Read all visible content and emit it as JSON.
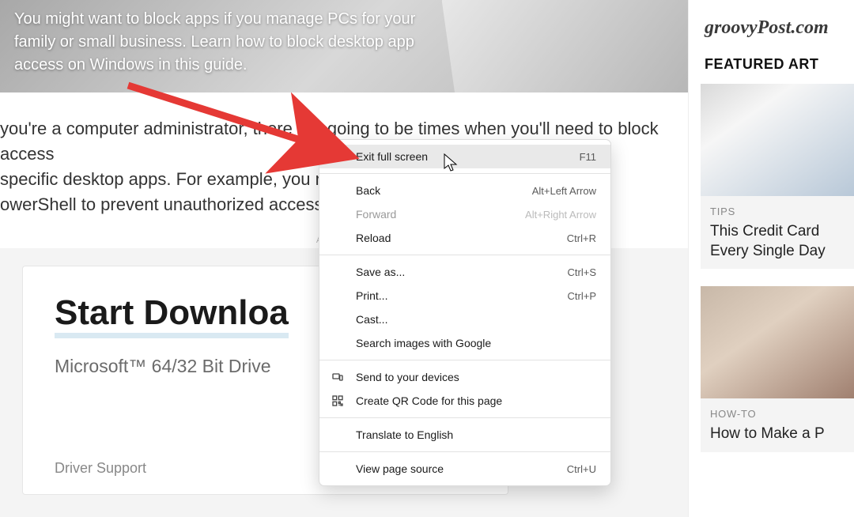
{
  "hero": {
    "text": "You might want to block apps if you manage PCs for your family or small business. Learn how to block desktop app access on Windows in this guide."
  },
  "article": {
    "line1": "you're a computer administrator, there are going to be times when you'll need to block access",
    "line2": "specific desktop apps. For example, you may want to block access to tools like",
    "line3": "owerShell to prevent unauthorized access"
  },
  "ad": {
    "label_row": "Advertisement",
    "headline": "Start Downloa",
    "sub": "Microsoft™ 64/32 Bit Drive",
    "sponsor": "Driver Support"
  },
  "site": {
    "logo": "groovyPost.com",
    "featured_heading": "FEATURED ART"
  },
  "featured": [
    {
      "category": "TIPS",
      "title": "This Credit Card Every Single Day"
    },
    {
      "category": "HOW-TO",
      "title": "How to Make a P"
    }
  ],
  "context_menu": {
    "items": [
      {
        "label": "Exit full screen",
        "shortcut": "F11",
        "highlight": true,
        "icon": null
      },
      {
        "sep": true
      },
      {
        "label": "Back",
        "shortcut": "Alt+Left Arrow",
        "icon": null
      },
      {
        "label": "Forward",
        "shortcut": "Alt+Right Arrow",
        "disabled": true,
        "icon": null
      },
      {
        "label": "Reload",
        "shortcut": "Ctrl+R",
        "icon": null
      },
      {
        "sep": true
      },
      {
        "label": "Save as...",
        "shortcut": "Ctrl+S",
        "icon": null
      },
      {
        "label": "Print...",
        "shortcut": "Ctrl+P",
        "icon": null
      },
      {
        "label": "Cast...",
        "shortcut": "",
        "icon": null
      },
      {
        "label": "Search images with Google",
        "shortcut": "",
        "icon": null
      },
      {
        "sep": true
      },
      {
        "label": "Send to your devices",
        "shortcut": "",
        "icon": "devices"
      },
      {
        "label": "Create QR Code for this page",
        "shortcut": "",
        "icon": "qr"
      },
      {
        "sep": true
      },
      {
        "label": "Translate to English",
        "shortcut": "",
        "icon": null
      },
      {
        "sep": true
      },
      {
        "label": "View page source",
        "shortcut": "Ctrl+U",
        "icon": null
      }
    ]
  }
}
